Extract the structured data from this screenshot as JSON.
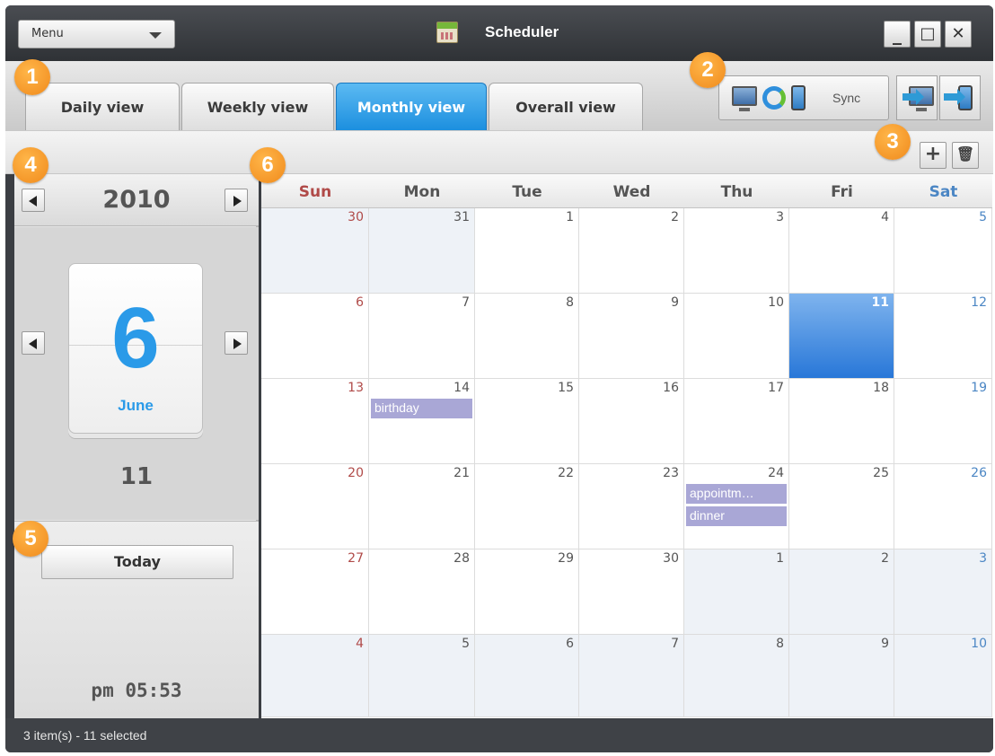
{
  "titlebar": {
    "menu_label": "Menu",
    "app_title": "Scheduler",
    "minimize": "_",
    "maximize": "□",
    "close": "✕"
  },
  "tabs": [
    {
      "label": "Daily view",
      "active": false
    },
    {
      "label": "Weekly view",
      "active": false
    },
    {
      "label": "Monthly view",
      "active": true
    },
    {
      "label": "Overall view",
      "active": false
    }
  ],
  "toolbar": {
    "sync_label": "Sync",
    "add": "+",
    "delete": "🗑"
  },
  "sidebar": {
    "year": "2010",
    "month_number": "6",
    "month_name": "June",
    "day": "11",
    "today_label": "Today",
    "time": "pm  05:53"
  },
  "calendar": {
    "weekdays": [
      "Sun",
      "Mon",
      "Tue",
      "Wed",
      "Thu",
      "Fri",
      "Sat"
    ],
    "weeks": [
      [
        "30",
        "31",
        "1",
        "2",
        "3",
        "4",
        "5"
      ],
      [
        "6",
        "7",
        "8",
        "9",
        "10",
        "11",
        "12"
      ],
      [
        "13",
        "14",
        "15",
        "16",
        "17",
        "18",
        "19"
      ],
      [
        "20",
        "21",
        "22",
        "23",
        "24",
        "25",
        "26"
      ],
      [
        "27",
        "28",
        "29",
        "30",
        "1",
        "2",
        "3"
      ],
      [
        "4",
        "5",
        "6",
        "7",
        "8",
        "9",
        "10"
      ]
    ],
    "selected_day": "11",
    "events": [
      {
        "week": 2,
        "day": 1,
        "slot": 0,
        "title": "birthday"
      },
      {
        "week": 3,
        "day": 4,
        "slot": 0,
        "title": "appointm…"
      },
      {
        "week": 3,
        "day": 4,
        "slot": 1,
        "title": "dinner"
      }
    ]
  },
  "status": {
    "text": "3 item(s) - 11 selected"
  },
  "markers": [
    "1",
    "2",
    "3",
    "4",
    "5",
    "6"
  ],
  "colors": {
    "accent": "#2a9ae8",
    "selected_cell": "#2877d8",
    "event": "#a9a7d6",
    "sunday": "#b04a48",
    "saturday": "#4b86c4",
    "marker": "#f08a1c"
  }
}
